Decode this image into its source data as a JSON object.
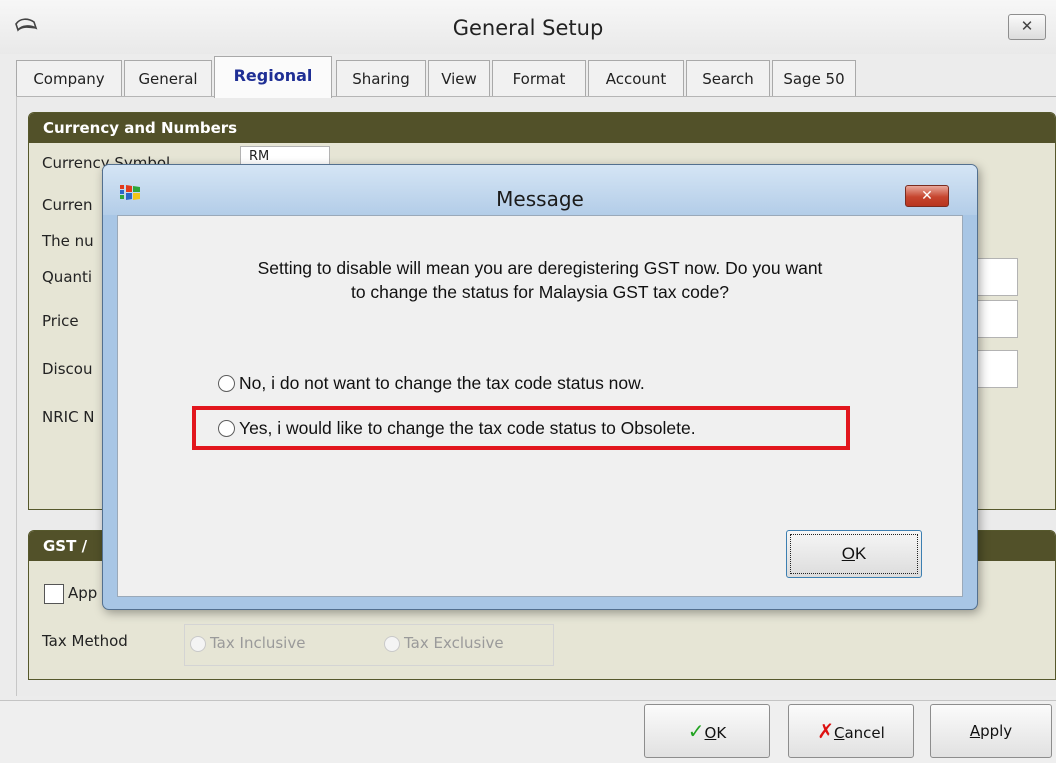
{
  "window": {
    "title": "General Setup",
    "close_glyph": "✕"
  },
  "tabs": [
    {
      "label": "Company"
    },
    {
      "label": "General"
    },
    {
      "label": "Regional",
      "active": true
    },
    {
      "label": "Sharing"
    },
    {
      "label": "View"
    },
    {
      "label": "Format"
    },
    {
      "label": "Account"
    },
    {
      "label": "Search"
    },
    {
      "label": "Sage 50"
    }
  ],
  "currency_section": {
    "header": "Currency and Numbers",
    "currency_symbol_label": "Currency Symbol",
    "currency_symbol_value": "RM",
    "row2_label": "Curren",
    "row3_label": "The nu",
    "quantity_label": "Quanti",
    "price_label": "Price",
    "discount_label": "Discou",
    "nric_label": "NRIC N"
  },
  "gst_section": {
    "header": "GST /",
    "apply_checkbox_label": "App",
    "tax_method_label": "Tax Method",
    "tax_inclusive_label": "Tax Inclusive",
    "tax_exclusive_label": "Tax Exclusive"
  },
  "buttons": {
    "ok_prefix": "",
    "ok_mnemonic": "O",
    "ok_rest": "K",
    "cancel_mnemonic": "C",
    "cancel_rest": "ancel",
    "apply_mnemonic": "A",
    "apply_rest": "pply"
  },
  "dialog": {
    "title": "Message",
    "close_glyph": "✕",
    "message_line1": "Setting to disable will mean you are deregistering GST now. Do you want",
    "message_line2": "to change the status for Malaysia GST tax code?",
    "option_no": "No, i do not want to change the tax code status now.",
    "option_yes": "Yes, i would like to change the tax code status to Obsolete.",
    "ok_mnemonic": "O",
    "ok_rest": "K"
  },
  "colors": {
    "section_header_bg": "#525129",
    "highlight_border": "#e2161d",
    "active_tab_text": "#1f2f95",
    "dialog_frame": "#a8c6e5"
  }
}
